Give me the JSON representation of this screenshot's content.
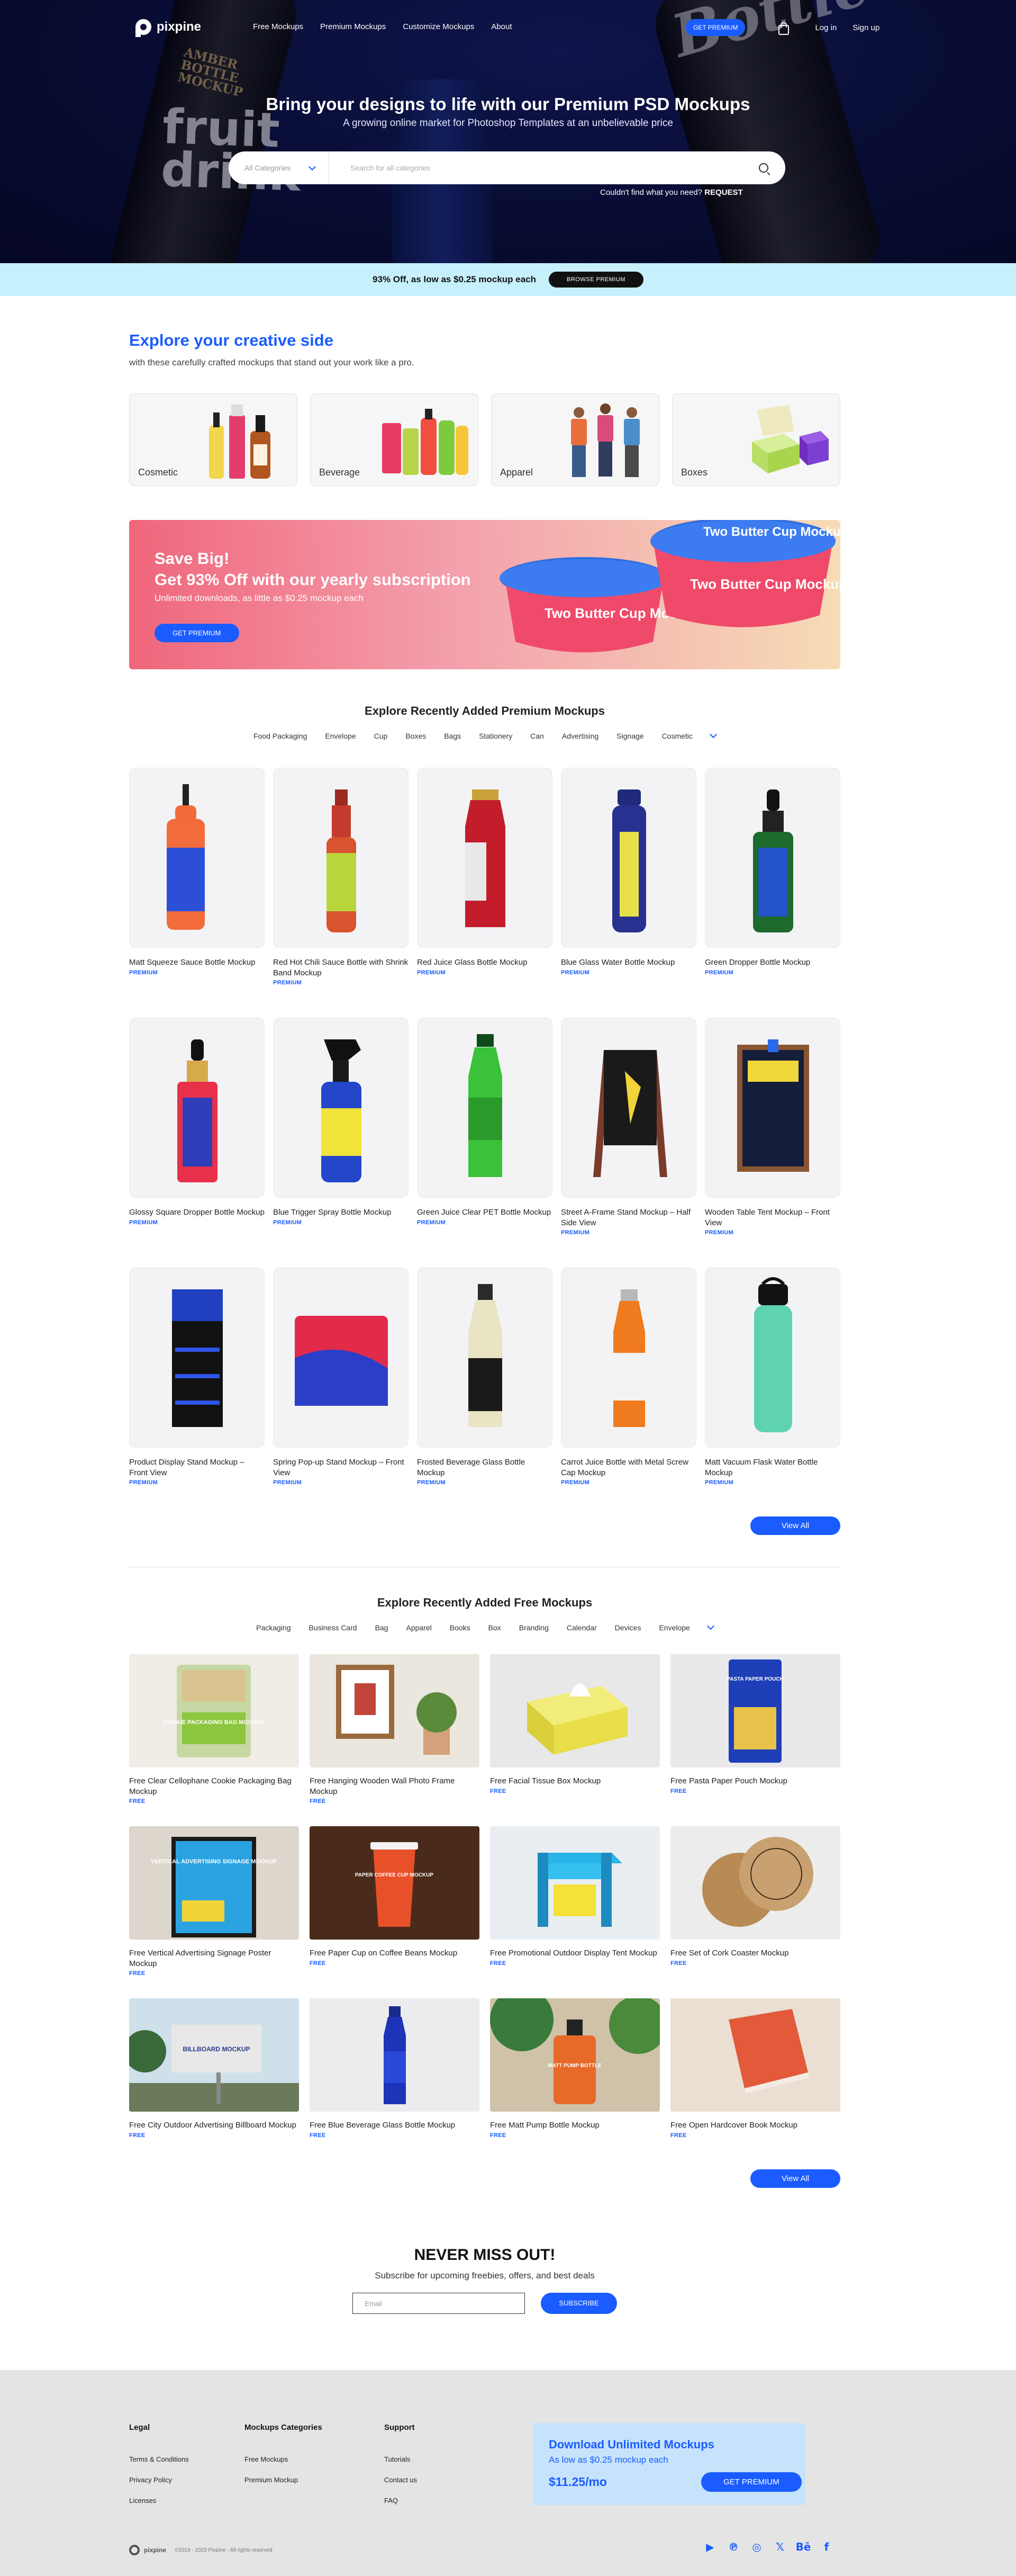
{
  "brand": {
    "name": "pixpine",
    "accent": "#1a5cff",
    "promo_bg": "#c6f0fb"
  },
  "nav": {
    "links": [
      "Free Mockups",
      "Premium Mockups",
      "Customize Mockups",
      "About"
    ],
    "premium_button": "GET PREMIUM",
    "cart_icon": "shopping-bag-icon",
    "login": "Log in",
    "signup": "Sign up"
  },
  "hero": {
    "title": "Bring your designs to life with our Premium PSD Mockups",
    "subtitle": "A growing online market for Photoshop Templates at an unbelievable price",
    "category_select": "All Categories",
    "search_placeholder": "Search for all categories",
    "request_text": "Couldn't find what you need?",
    "request_link": "REQUEST",
    "bottle_texts": {
      "amber": "AMBER BOTTLE MOCKUP",
      "fruit": "fruit drink",
      "bottle": "Bottle"
    }
  },
  "promo_strip": {
    "text": "93% Off, as low as $0.25 mockup each",
    "button": "BROWSE PREMIUM"
  },
  "creative": {
    "title": "Explore your creative side",
    "subtitle": "with these carefully crafted mockups that stand out your work like a pro.",
    "categories": [
      "Cosmetic",
      "Beverage",
      "Apparel",
      "Boxes"
    ]
  },
  "save_banner": {
    "title1": "Save Big!",
    "title2": "Get 93% Off with our yearly subscription",
    "subtitle": "Unlimited downloads, as little as $0.25 mockup each",
    "button": "GET PREMIUM",
    "tub_text": "Two Butter Cup Mockup"
  },
  "premium": {
    "title": "Explore Recently Added Premium Mockups",
    "filters": [
      "Food Packaging",
      "Envelope",
      "Cup",
      "Boxes",
      "Bags",
      "Stationery",
      "Can",
      "Advertising",
      "Signage",
      "Cosmetic"
    ],
    "tag": "PREMIUM",
    "items": [
      "Matt Squeeze Sauce Bottle Mockup",
      "Red Hot Chili Sauce Bottle with Shrink Band Mockup",
      "Red Juice Glass Bottle Mockup",
      "Blue Glass Water Bottle Mockup",
      "Green Dropper Bottle Mockup",
      "Glossy Square Dropper Bottle Mockup",
      "Blue Trigger Spray Bottle Mockup",
      "Green Juice Clear PET Bottle Mockup",
      "Street A-Frame Stand Mockup – Half Side View",
      "Wooden Table Tent Mockup – Front View",
      "Product Display Stand Mockup – Front View",
      "Spring Pop-up Stand Mockup – Front View",
      "Frosted Beverage Glass Bottle Mockup",
      "Carrot Juice Bottle with Metal Screw Cap Mockup",
      "Matt Vacuum Flask Water Bottle Mockup"
    ],
    "view_all": "View All"
  },
  "free": {
    "title": "Explore Recently Added Free Mockups",
    "filters": [
      "Packaging",
      "Business Card",
      "Bag",
      "Apparel",
      "Books",
      "Box",
      "Branding",
      "Calendar",
      "Devices",
      "Envelope"
    ],
    "tag": "FREE",
    "items": [
      "Free Clear Cellophane Cookie Packaging Bag Mockup",
      "Free Hanging Wooden Wall Photo Frame Mockup",
      "Free Facial Tissue Box Mockup",
      "Free Pasta Paper Pouch Mockup",
      "Free Vertical Advertising Signage Poster Mockup",
      "Free Paper Cup on Coffee Beans Mockup",
      "Free Promotional Outdoor Display Tent Mockup",
      "Free Set of Cork Coaster Mockup",
      "Free City Outdoor Advertising Billboard Mockup",
      "Free Blue Beverage Glass Bottle Mockup",
      "Free Matt Pump Bottle Mockup",
      "Free Open Hardcover Book Mockup"
    ],
    "thumb_texts": {
      "cookie": "COOKIE PACKAGING BAG MOCKUP",
      "pouch": "PASTA PAPER POUCH",
      "poster": "VERTICAL ADVERTISING SIGNAGE MOCKUP",
      "cup": "PAPER COFFEE CUP MOCKUP",
      "billboard": "BILLBOARD MOCKUP",
      "pump": "MATT PUMP BOTTLE"
    },
    "view_all": "View All"
  },
  "newsletter": {
    "title": "NEVER MISS OUT!",
    "subtitle": "Subscribe for upcoming freebies, offers, and best deals",
    "placeholder": "Email",
    "button": "SUBSCRIBE"
  },
  "footer": {
    "legal": {
      "title": "Legal",
      "items": [
        "Terms & Conditions",
        "Privacy Policy",
        "Licenses"
      ]
    },
    "categories": {
      "title": "Mockups Categories",
      "items": [
        "Free Mockups",
        "Premium Mockup"
      ]
    },
    "support": {
      "title": "Support",
      "items": [
        "Tutorials",
        "Contact us",
        "FAQ"
      ]
    },
    "promo": {
      "title": "Download Unlimited Mockups",
      "subtitle": "As low as $0.25 mockup each",
      "price": "$11.25/mo",
      "button": "GET PREMIUM"
    },
    "logo": "pixpine",
    "copyright": "©2019 - 2023 Pixpine - All rights reserved",
    "socials": [
      "youtube-icon",
      "pinterest-icon",
      "instagram-icon",
      "x-icon",
      "behance-icon",
      "facebook-icon"
    ],
    "social_glyphs": [
      "▶",
      "℗",
      "◎",
      "𝕏",
      "Bē",
      "f"
    ]
  }
}
